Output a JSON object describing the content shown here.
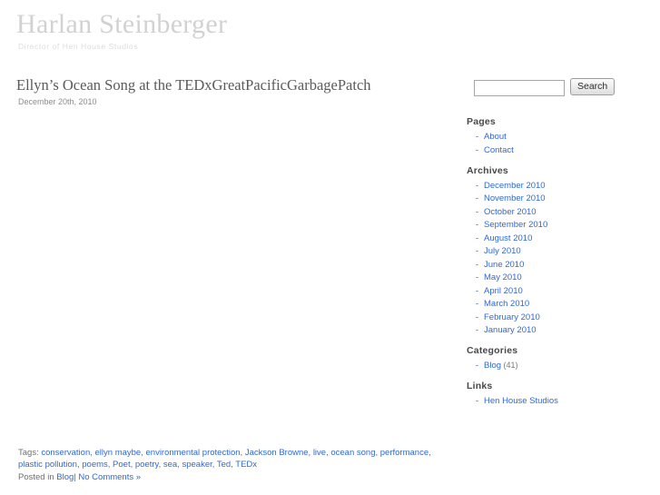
{
  "header": {
    "site_title": "Harlan Steinberger",
    "site_description": "Director of Hen House Studios"
  },
  "post": {
    "title": "Ellyn’s Ocean Song at the TEDxGreatPacificGarbagePatch",
    "date": "December 20th, 2010",
    "tags_label": "Tags:",
    "tags": [
      "conservation",
      "ellyn maybe",
      "environmental protection",
      "Jackson Browne",
      "live",
      "ocean song",
      "performance",
      "plastic pollution",
      "poems",
      "Poet",
      "poetry",
      "sea",
      "speaker",
      "Ted",
      "TEDx"
    ],
    "posted_in_label": "Posted in",
    "category": "Blog",
    "separator": "|",
    "comments_link": "No Comments »"
  },
  "sidebar": {
    "search": {
      "value": "",
      "placeholder": "",
      "button_label": "Search"
    },
    "widgets": [
      {
        "title": "Pages",
        "items": [
          {
            "label": "About"
          },
          {
            "label": "Contact"
          }
        ]
      },
      {
        "title": "Archives",
        "items": [
          {
            "label": "December 2010"
          },
          {
            "label": "November 2010"
          },
          {
            "label": "October 2010"
          },
          {
            "label": "September 2010"
          },
          {
            "label": "August 2010"
          },
          {
            "label": "July 2010"
          },
          {
            "label": "June 2010"
          },
          {
            "label": "May 2010"
          },
          {
            "label": "April 2010"
          },
          {
            "label": "March 2010"
          },
          {
            "label": "February 2010"
          },
          {
            "label": "January 2010"
          }
        ]
      },
      {
        "title": "Categories",
        "items": [
          {
            "label": "Blog",
            "count": "(41)"
          }
        ]
      },
      {
        "title": "Links",
        "items": [
          {
            "label": "Hen House Studios"
          }
        ]
      }
    ]
  },
  "colors": {
    "link": "#3069d3",
    "site_title": "#d2d2d2",
    "text": "#6f6f6f"
  }
}
